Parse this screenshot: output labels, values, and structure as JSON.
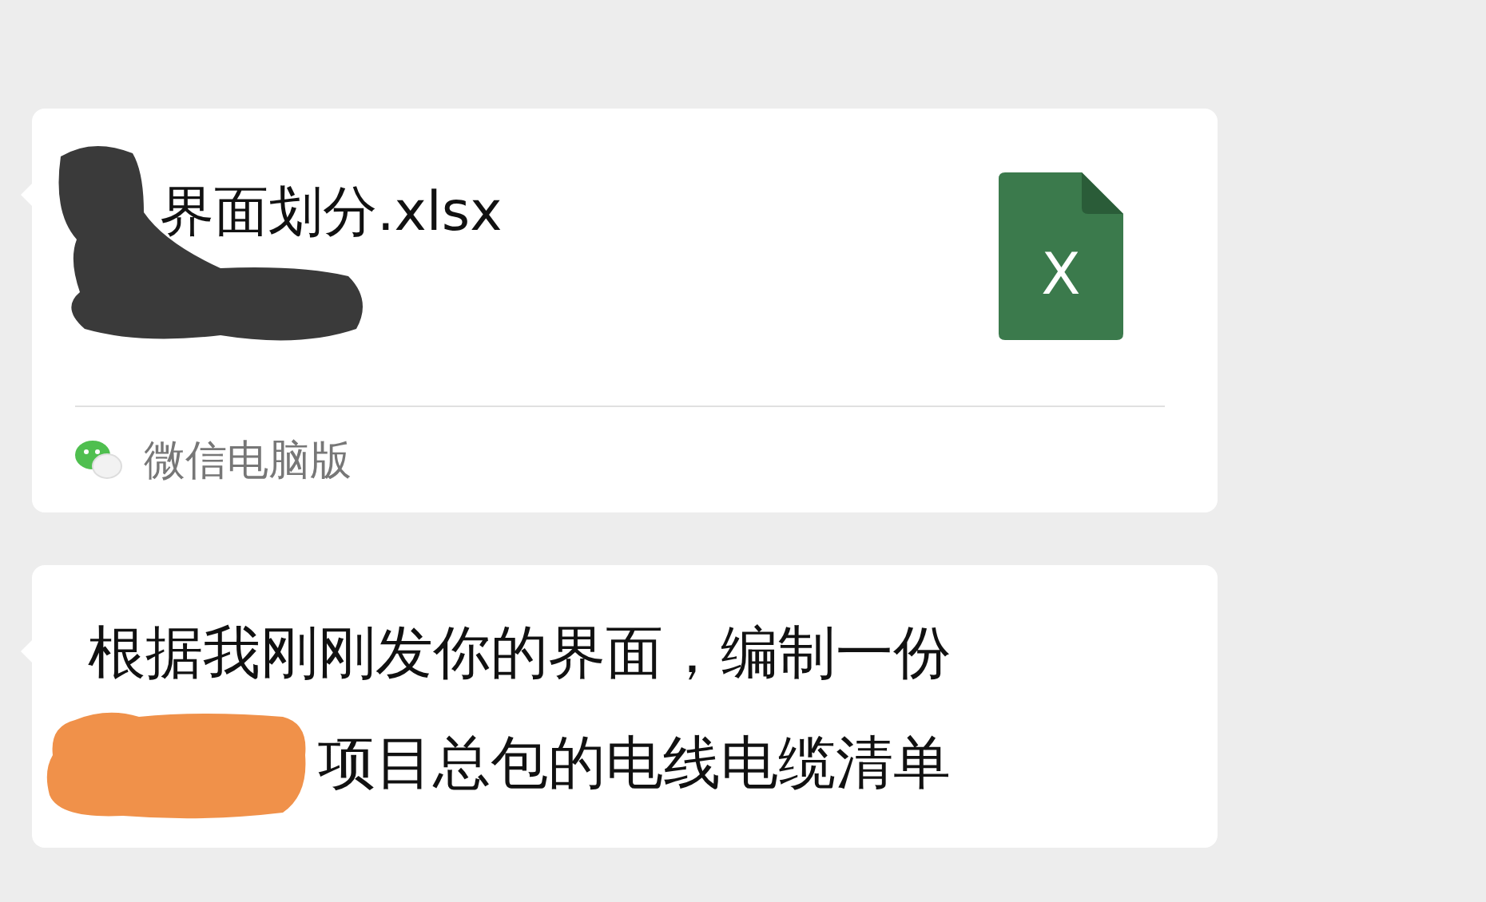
{
  "file_message": {
    "file_name": "界面划分.xlsx",
    "icon_text": "X",
    "source": "微信电脑版",
    "redacted": true
  },
  "text_message": {
    "lines": [
      "根据我刚刚发你的界面，编制一份",
      "项目总包的电线电缆清单"
    ],
    "redacted": true
  }
}
